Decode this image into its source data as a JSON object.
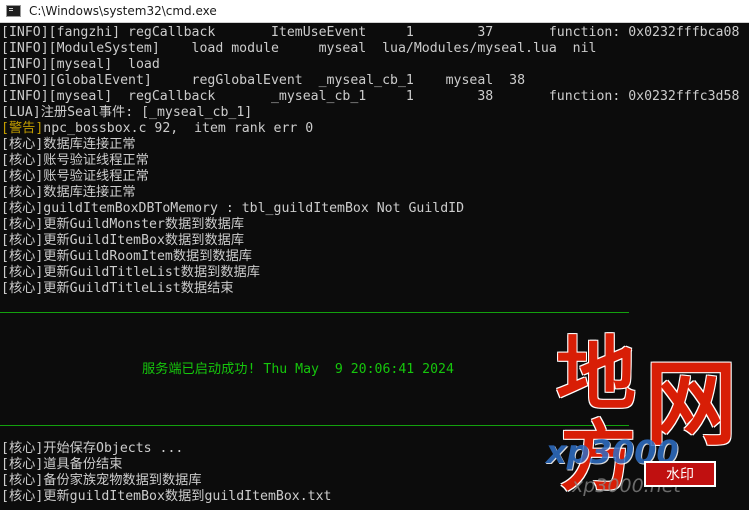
{
  "window": {
    "title": "C:\\Windows\\system32\\cmd.exe",
    "icon": "cmd-icon"
  },
  "console": {
    "lines_top": [
      {
        "text": "[INFO][fangzhi] regCallback       ItemUseEvent     1        37       function: 0x0232fffbca08",
        "color": "#cccccc"
      },
      {
        "text": "[INFO][ModuleSystem]    load module     myseal  lua/Modules/myseal.lua  nil",
        "color": "#cccccc"
      },
      {
        "text": "[INFO][myseal]  load",
        "color": "#cccccc"
      },
      {
        "text": "[INFO][GlobalEvent]     regGlobalEvent  _myseal_cb_1    myseal  38",
        "color": "#cccccc"
      },
      {
        "text": "[INFO][myseal]  regCallback       _myseal_cb_1     1        38       function: 0x0232fffc3d58",
        "color": "#cccccc"
      },
      {
        "text": "[LUA]注册Seal事件: [_myseal_cb_1]",
        "color": "#cccccc"
      },
      {
        "prefix": "[警告]",
        "text": "npc_bossbox.c 92,  item rank err 0",
        "color": "#cccccc",
        "prefix_color": "#c19c00"
      },
      {
        "text": "[核心]数据库连接正常",
        "color": "#cccccc"
      },
      {
        "text": "[核心]账号验证线程正常",
        "color": "#cccccc"
      },
      {
        "text": "[核心]账号验证线程正常",
        "color": "#cccccc"
      },
      {
        "text": "[核心]数据库连接正常",
        "color": "#cccccc"
      },
      {
        "text": "[核心]guildItemBoxDBToMemory : tbl_guildItemBox Not GuildID",
        "color": "#cccccc"
      },
      {
        "text": "[核心]更新GuildMonster数据到数据库",
        "color": "#cccccc"
      },
      {
        "text": "[核心]更新GuildItemBox数据到数据库",
        "color": "#cccccc"
      },
      {
        "text": "[核心]更新GuildRoomItem数据到数据库",
        "color": "#cccccc"
      },
      {
        "text": "[核心]更新GuildTitleList数据到数据库",
        "color": "#cccccc"
      },
      {
        "text": "[核心]更新GuildTitleList数据结束",
        "color": "#cccccc"
      }
    ],
    "status_line": "服务端已启动成功! Thu May  9 20:06:41 2024",
    "status_color": "#16c60c",
    "separator_color": "#13a10e",
    "lines_bottom": [
      {
        "text": "[核心]开始保存Objects ...",
        "color": "#cccccc"
      },
      {
        "text": "[核心]道具备份结束",
        "color": "#cccccc"
      },
      {
        "text": "[核心]备份家族宠物数据到数据库",
        "color": "#cccccc"
      },
      {
        "text": "[核心]更新guildItemBox数据到guildItemBox.txt",
        "color": "#cccccc"
      }
    ]
  },
  "watermark": {
    "chars": [
      "地",
      "网",
      "方"
    ],
    "brand": "xp3000",
    "url": "xp3000.net",
    "stamp": "水印",
    "color": "#d81e06"
  }
}
